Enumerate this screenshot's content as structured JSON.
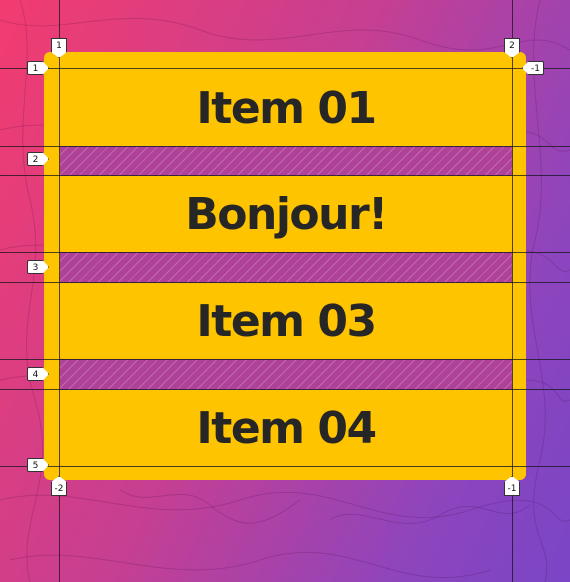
{
  "items": [
    {
      "label": "Item 01"
    },
    {
      "label": "Bonjour!"
    },
    {
      "label": "Item 03"
    },
    {
      "label": "Item 04"
    }
  ],
  "grid_overlay": {
    "row_line_numbers": [
      "1",
      "2",
      "3",
      "4",
      "5"
    ],
    "column_line_numbers_top": [
      "1",
      "2"
    ],
    "column_line_numbers_bottom": [
      "-2",
      "-1"
    ],
    "row_negative_right": "-1"
  },
  "colors": {
    "background_start": "#f23c6f",
    "background_end": "#7a45c6",
    "item_fill": "#ffc400",
    "item_text": "#262626"
  }
}
